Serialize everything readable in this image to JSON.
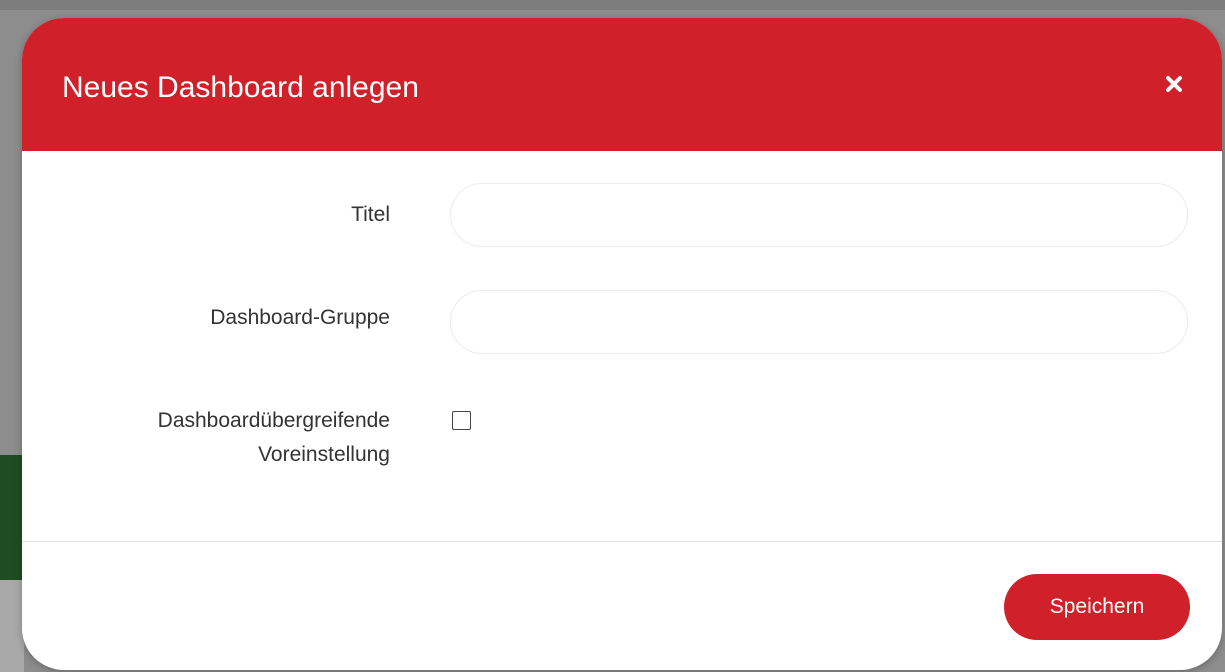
{
  "modal": {
    "title": "Neues Dashboard anlegen",
    "close_icon": "close-icon",
    "header_color": "#d0202a"
  },
  "form": {
    "title_label": "Titel",
    "title_value": "",
    "group_label": "Dashboard-Gruppe",
    "group_value": "",
    "default_label_line1": "Dashboardübergreifende",
    "default_label_line2": "Voreinstellung",
    "default_checked": false
  },
  "footer": {
    "save_label": "Speichern",
    "save_color": "#d0202a"
  }
}
